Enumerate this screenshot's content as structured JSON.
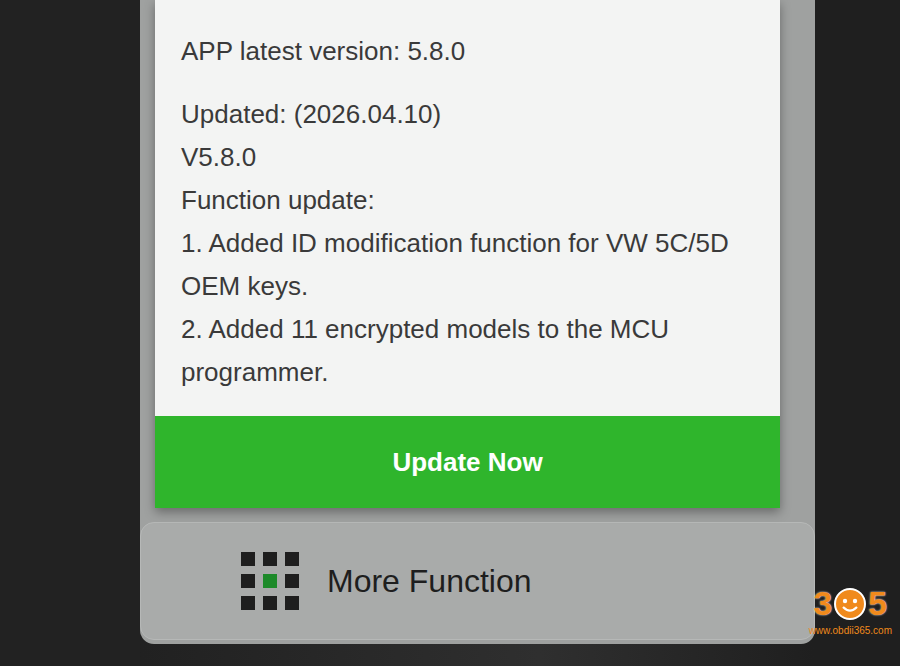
{
  "dialog": {
    "paragraphs": [
      [
        "APP latest version: 5.8.0"
      ],
      [
        "Updated: (2026.04.10)",
        "V5.8.0",
        "Function update:",
        "1. Added ID modification function for VW 5C/5D OEM keys.",
        "2. Added 11 encrypted models to the MCU programmer."
      ]
    ],
    "button": "Update Now"
  },
  "menu": [
    {
      "label": "More Function"
    }
  ],
  "watermark": {
    "left": "3",
    "right": "5",
    "url": "www.obdii365.com"
  }
}
